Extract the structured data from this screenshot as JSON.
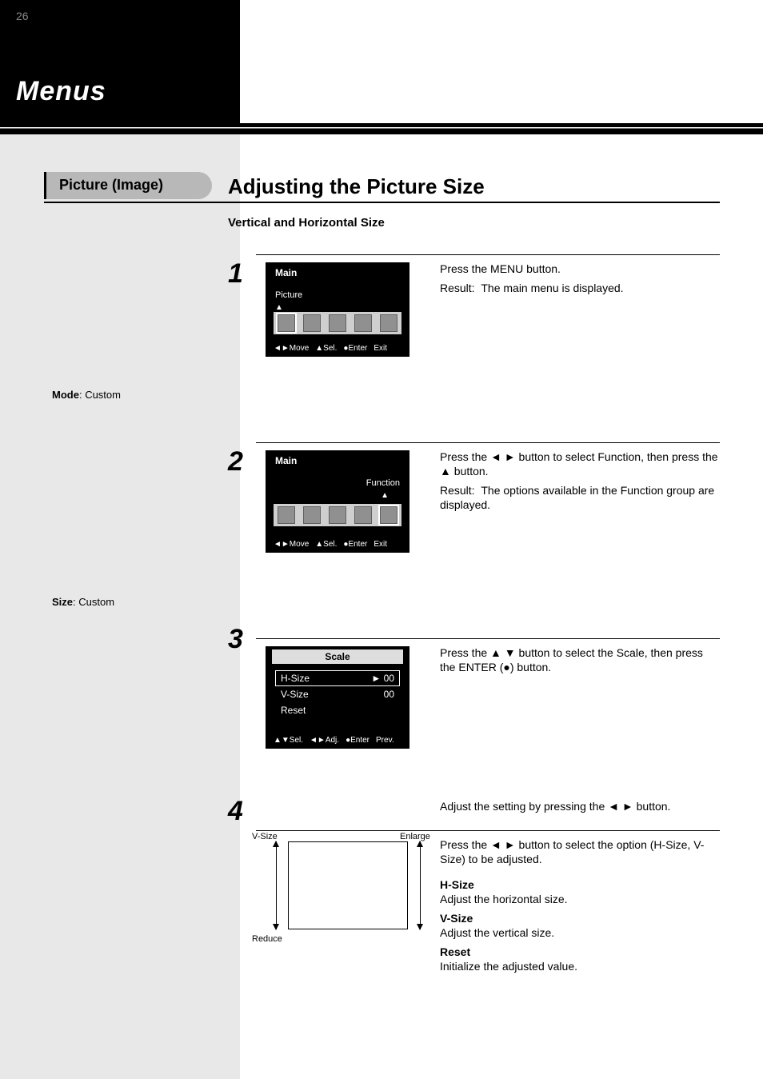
{
  "page_number": "26",
  "chapter_title": "Menus",
  "section_pill": "Picture (Image)",
  "heading": "Adjusting the Picture Size",
  "subheading": "Vertical and Horizontal Size",
  "steps": {
    "s1": {
      "num": "1",
      "text": "Press the MENU button.",
      "result": "Result:  The main menu is displayed.",
      "side_label": "Mode",
      "side_value": "Custom"
    },
    "s2": {
      "num": "2",
      "text_a": "Press the ",
      "text_b": " button to select Function, then press the ",
      "text_c": " button.",
      "result": "Result:  The options available in the Function group are displayed.",
      "side_label": "Size",
      "side_value": "Custom"
    },
    "s3": {
      "num": "3",
      "text_a": "Press the ",
      "text_b": " button to select the Scale, then press the ENTER (",
      "text_c": ") button.",
      "osd_title": "Scale",
      "items": [
        {
          "name": "H-Size",
          "val": "00"
        },
        {
          "name": "V-Size",
          "val": "00"
        },
        {
          "name": "Reset",
          "val": ""
        }
      ]
    },
    "s4": {
      "num": "4",
      "line1_a": "Adjust the setting by pressing the ",
      "line1_b": " button.",
      "head_a": "Press the ",
      "head_b": " button to select the option (H-Size, V-Size) to be adjusted.",
      "hsize_label": "H-Size",
      "hsize_desc": "Adjust the horizontal size.",
      "vsize_label": "V-Size",
      "vsize_desc": "Adjust the vertical size.",
      "reset_label": "Reset",
      "reset_desc": "Initialize the adjusted value.",
      "diag": {
        "left_top": "V-Size",
        "left_bot": "Reduce",
        "right_top": "Enlarge"
      }
    }
  },
  "osd_common": {
    "main_title": "Main",
    "func_title": "Function",
    "move_label": "Move",
    "sel_label": "Sel.",
    "enter_label": "Enter",
    "exit_label": "Exit",
    "adj_label": "Adj.",
    "prev_label": "Prev."
  }
}
